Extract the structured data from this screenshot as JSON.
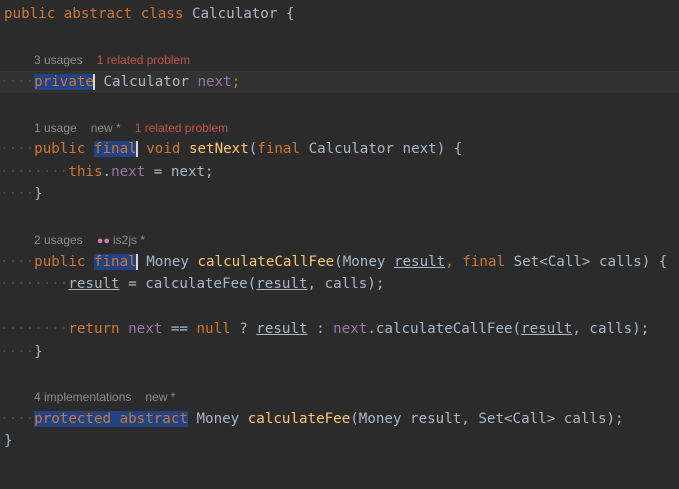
{
  "inlays": {
    "next_usages": "3 usages",
    "next_problem": "1 related problem",
    "setnext_usage": "1 usage",
    "setnext_new": "new *",
    "setnext_problem": "1 related problem",
    "callfee_usages": "2 usages",
    "callfee_author": "is2js *",
    "calcfee_impls": "4 implementations",
    "calcfee_new": "new *"
  },
  "icons": {
    "author": "people-icon"
  },
  "colors": {
    "background": "#2b2b2b",
    "keyword": "#cc7832",
    "field": "#9876aa",
    "function": "#ffc66d",
    "text": "#a9b7c6",
    "selection": "#214283",
    "problem": "#c75450"
  },
  "code": {
    "l1": {
      "k1": "public",
      "k2": "abstract",
      "k3": "class",
      "cls": "Calculator",
      "brace": "{"
    },
    "l2": {
      "k1": "private",
      "type": "Calculator",
      "field": "next",
      "semi": ";"
    },
    "l3": {
      "k1": "public",
      "k2": "final",
      "k3": "void",
      "fn": "setNext",
      "p1": "(",
      "k4": "final",
      "ptype": "Calculator",
      "pname": "next",
      "p2": ")",
      "brace": "{"
    },
    "l4": {
      "self": "this",
      "dot": ".",
      "field": "next",
      "rest": " = next;"
    },
    "l5": {
      "brace": "}"
    },
    "l6": {
      "k1": "public",
      "k2": "final",
      "rtype": "Money",
      "fn": "calculateCallFee",
      "p1": "(Money ",
      "arg1": "result",
      "comma": ", ",
      "k3": "final",
      "rest": " Set<Call> calls) {"
    },
    "l7": {
      "var": "result",
      "eq": " = calculateFee(",
      "arg": "result",
      "rest": ", calls);"
    },
    "l8": {
      "k1": "return",
      "field": "next",
      "op": " == ",
      "k2": "null",
      "q": " ? ",
      "v1": "result",
      "colon": " : ",
      "field2": "next",
      "mid": ".calculateCallFee(",
      "v2": "result",
      "rest": ", calls);"
    },
    "l9": {
      "brace": "}"
    },
    "l10": {
      "k1": "protected",
      "k2": "abstract",
      "rtype": "Money",
      "fn": "calculateFee",
      "rest": "(Money result, Set<Call> calls);"
    },
    "l11": {
      "brace": "}"
    }
  }
}
